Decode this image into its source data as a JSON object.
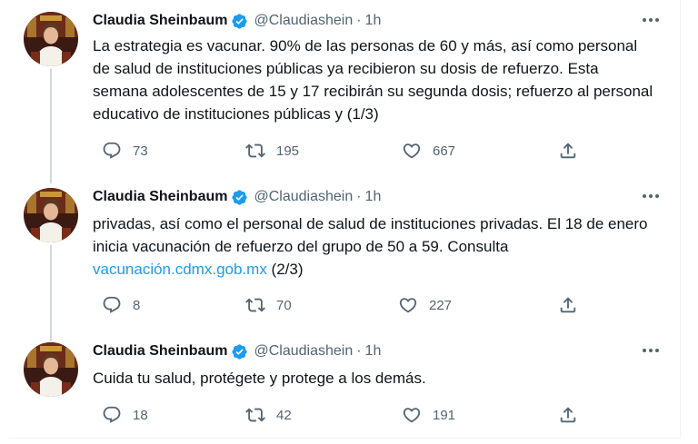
{
  "tweets": [
    {
      "author": "Claudia Sheinbaum",
      "handle": "@Claudiashein",
      "separator": "·",
      "time": "1h",
      "text": "La estrategia es vacunar. 90% de las personas de 60 y más, así como personal de salud de instituciones públicas ya recibieron su dosis de refuerzo. Esta semana adolescentes de 15 y 17 recibirán su segunda dosis; refuerzo al personal educativo de instituciones públicas y  (1/3)",
      "replies": "73",
      "retweets": "195",
      "likes": "667"
    },
    {
      "author": "Claudia Sheinbaum",
      "handle": "@Claudiashein",
      "separator": "·",
      "time": "1h",
      "text": "privadas, así como el personal de salud de instituciones privadas. El 18 de enero inicia vacunación de refuerzo del grupo de 50 a 59. Consulta",
      "link": "vacunación.cdmx.gob.mx",
      "text_suffix": " (2/3)",
      "replies": "8",
      "retweets": "70",
      "likes": "227"
    },
    {
      "author": "Claudia Sheinbaum",
      "handle": "@Claudiashein",
      "separator": "·",
      "time": "1h",
      "text": "Cuida tu salud, protégete y protege a los demás.",
      "replies": "18",
      "retweets": "42",
      "likes": "191"
    }
  ],
  "colors": {
    "text": "#0f1419",
    "secondary": "#536471",
    "link": "#1d9bf0",
    "verified": "#1d9bf0",
    "thread_line": "#cfd9de"
  },
  "icons": {
    "verified": "verified-badge-icon",
    "more": "more-horizontal-icon",
    "reply": "reply-icon",
    "retweet": "retweet-icon",
    "like": "heart-icon",
    "share": "share-icon"
  }
}
